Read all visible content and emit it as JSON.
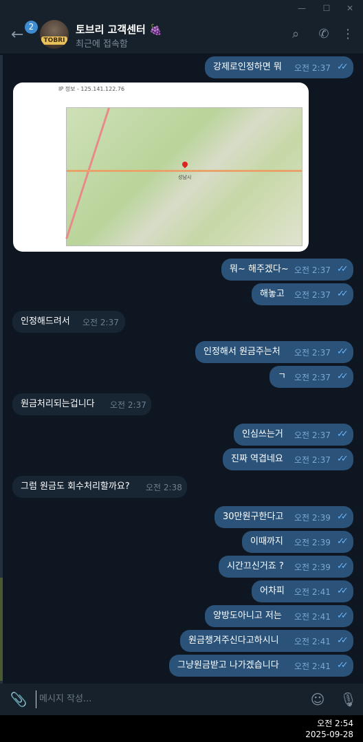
{
  "window": {
    "minimize": "—",
    "maximize": "☐",
    "close": "✕"
  },
  "header": {
    "back_badge": "2",
    "avatar_text": "TOBRI",
    "title": "토브리 고객센터 🍇",
    "status": "최근에 접속함"
  },
  "image_message": {
    "caption": "IP 정보 - 125.141.122.76",
    "map_city_label": "성남시"
  },
  "messages": [
    {
      "dir": "out",
      "text": "강제로인정하면 뭐",
      "time": "오전 2:37"
    },
    {
      "dir": "out",
      "text": "뭐~ 해주겠다~",
      "time": "오전 2:37"
    },
    {
      "dir": "out",
      "text": "해놓고",
      "time": "오전 2:37"
    },
    {
      "dir": "in",
      "text": "인정해드려서",
      "time": "오전 2:37"
    },
    {
      "dir": "out",
      "text": "인정해서 원금주는처",
      "time": "오전 2:37"
    },
    {
      "dir": "out",
      "text": "ㄱ",
      "time": "오전 2:37"
    },
    {
      "dir": "in",
      "text": "원금처리되는겁니다",
      "time": "오전 2:37"
    },
    {
      "dir": "out",
      "text": "인심쓰는거",
      "time": "오전 2:37"
    },
    {
      "dir": "out",
      "text": "진짜 역겹네요",
      "time": "오전 2:37"
    },
    {
      "dir": "in",
      "text": "그럼 원금도 회수처리할까요?",
      "time": "오전 2:38"
    },
    {
      "dir": "out",
      "text": "30만원구한다고",
      "time": "오전 2:39"
    },
    {
      "dir": "out",
      "text": "이때까지",
      "time": "오전 2:39"
    },
    {
      "dir": "out",
      "text": "시간끄신거죠 ?",
      "time": "오전 2:39"
    },
    {
      "dir": "out",
      "text": "어차피",
      "time": "오전 2:41"
    },
    {
      "dir": "out",
      "text": "양방도아니고 저는",
      "time": "오전 2:41"
    },
    {
      "dir": "out",
      "text": "원금챙겨주신다고하시니",
      "time": "오전 2:41"
    },
    {
      "dir": "out",
      "text": "그냥원금받고 나가겠습니다",
      "time": "오전 2:41"
    }
  ],
  "composer": {
    "placeholder": "메시지 작성..."
  },
  "taskbar": {
    "time": "오전 2:54",
    "date": "2025-09-28"
  },
  "icons": {
    "back": "←",
    "search": "⌕",
    "phone": "✆",
    "more": "⋮",
    "attach": "📎",
    "emoji": "☺",
    "mic": "🎙",
    "read_check": "✓✓"
  },
  "colors": {
    "background": "#0e1621",
    "header": "#17212b",
    "outgoing_bubble": "#2b5278",
    "incoming_bubble": "#182533",
    "read_check": "#6ab3f3"
  }
}
